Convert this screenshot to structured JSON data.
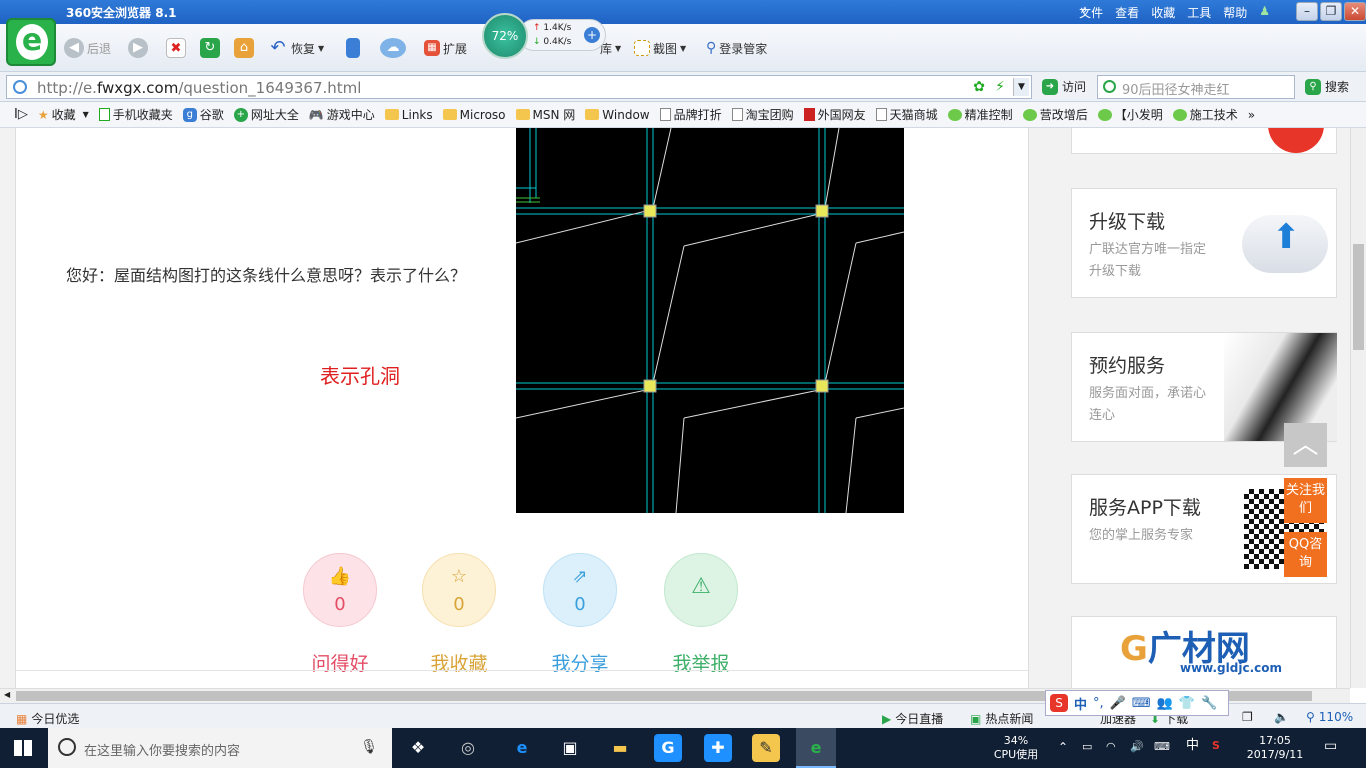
{
  "browser": {
    "title": "360安全浏览器 8.1",
    "menu": [
      "文件",
      "查看",
      "收藏",
      "工具",
      "帮助"
    ],
    "window_buttons": [
      "–",
      "❐",
      "✕"
    ]
  },
  "toolbar": {
    "back": "后退",
    "restore": "恢复",
    "extend": "扩展",
    "screenshot": "截图",
    "login": "登录管家",
    "hidden_partial": "库",
    "speed": {
      "percent": "72%",
      "up": "1.4K/s",
      "down": "0.4K/s"
    }
  },
  "address": {
    "url_prefix": "http://e.",
    "url_domain": "fwxgx.com",
    "url_path": "/question_1649367.html",
    "visit": "访问",
    "search_placeholder": "90后田径女神走红",
    "search_btn": "搜索"
  },
  "bookmarks": [
    "收藏",
    "手机收藏夹",
    "谷歌",
    "网址大全",
    "游戏中心",
    "Links",
    "Microso",
    "MSN 网",
    "Window",
    "品牌打折",
    "淘宝团购",
    "外国网友",
    "天猫商城",
    "精准控制",
    "营改增后",
    "【小发明",
    "施工技术"
  ],
  "content": {
    "question": "您好：屋面结构图打的这条线什么意思呀？表示了什么？",
    "answer": "表示孔洞",
    "actions": [
      {
        "label": "问得好",
        "count": "0"
      },
      {
        "label": "我收藏",
        "count": "0"
      },
      {
        "label": "我分享",
        "count": "0"
      },
      {
        "label": "我举报",
        "count": ""
      }
    ]
  },
  "sidebar": [
    {
      "title": "升级下载",
      "desc": "广联达官方唯一指定升级下载"
    },
    {
      "title": "预约服务",
      "desc": "服务面对面，承诺心连心"
    },
    {
      "title": "服务APP下载",
      "desc": "您的掌上服务专家"
    }
  ],
  "float": {
    "follow": "关注我们",
    "qq": "QQ咨询",
    "to_top": "︿"
  },
  "glodon": {
    "name": "广材网",
    "url": "www.gldjc.com"
  },
  "statusbar": {
    "left": "今日优选",
    "live": "今日直播",
    "news": "热点新闻",
    "accel": "加速器",
    "download": "下载",
    "zoom": "110%"
  },
  "ime": {
    "lang": "中",
    "punct": "°,"
  },
  "taskbar": {
    "search_placeholder": "在这里输入你要搜索的内容",
    "cpu_percent": "34%",
    "cpu_label": "CPU使用",
    "lang": "中",
    "time": "17:05",
    "date": "2017/9/11"
  },
  "colors": {
    "accent_red": "#e02020",
    "like": "#e34d66",
    "fav": "#d9a53a",
    "share": "#3a9fdc",
    "report": "#3fb06a",
    "orange": "#f07020"
  }
}
